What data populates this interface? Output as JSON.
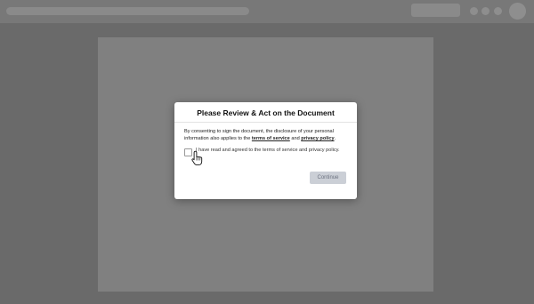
{
  "modal": {
    "title": "Please Review & Act on the Document",
    "body_prefix": "By consenting to sign the document, the disclosure of your personal information also applies to the ",
    "terms_link": "terms of service",
    "and_text": " and ",
    "privacy_link": "privacy policy",
    "body_suffix": ".",
    "consent_label": "I have read and agreed to the terms of service and privacy policy.",
    "consent_checked": false,
    "continue_label": "Continue",
    "continue_enabled": false
  },
  "colors": {
    "overlay": "#6b6b6b",
    "modal_bg": "#ffffff",
    "button_disabled_bg": "#cbcfd6",
    "button_disabled_text": "#6c7280"
  },
  "icons": [
    "hand-pointer-icon"
  ]
}
